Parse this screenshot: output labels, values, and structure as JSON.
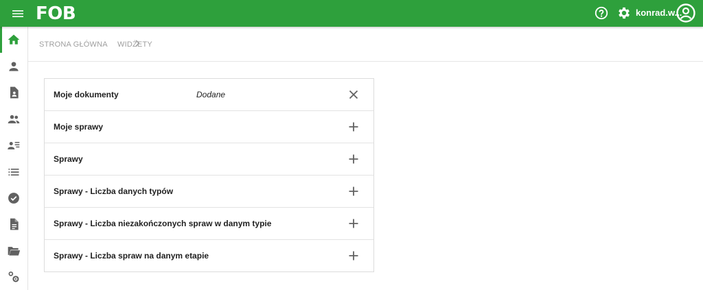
{
  "app": {
    "logo_text": "FOB"
  },
  "header": {
    "user_name": "konrad.w...",
    "icons": [
      "menu-icon",
      "help-icon",
      "gear-icon",
      "account-circle-icon"
    ],
    "brand_color": "#2ea03c"
  },
  "sidebar": {
    "items": [
      {
        "icon": "home-icon",
        "active": true
      },
      {
        "icon": "person-icon",
        "active": false
      },
      {
        "icon": "contact-document-icon",
        "active": false
      },
      {
        "icon": "people-icon",
        "active": false
      },
      {
        "icon": "person-list-icon",
        "active": false
      },
      {
        "icon": "list-icon",
        "active": false
      },
      {
        "icon": "check-circle-icon",
        "active": false
      },
      {
        "icon": "document-icon",
        "active": false
      },
      {
        "icon": "folder-open-icon",
        "active": false
      },
      {
        "icon": "settings-gears-icon",
        "active": false
      }
    ]
  },
  "breadcrumb": {
    "home": "STRONA GŁÓWNA",
    "current": "WIDŻETY"
  },
  "widgets": [
    {
      "name": "Moje dokumenty",
      "status": "Dodane",
      "action": "remove"
    },
    {
      "name": "Moje sprawy",
      "status": "",
      "action": "add"
    },
    {
      "name": "Sprawy",
      "status": "",
      "action": "add"
    },
    {
      "name": "Sprawy - Liczba danych typów",
      "status": "",
      "action": "add"
    },
    {
      "name": "Sprawy - Liczba niezakończonych spraw w danym typie",
      "status": "",
      "action": "add"
    },
    {
      "name": "Sprawy - Liczba spraw na danym etapie",
      "status": "",
      "action": "add"
    }
  ]
}
